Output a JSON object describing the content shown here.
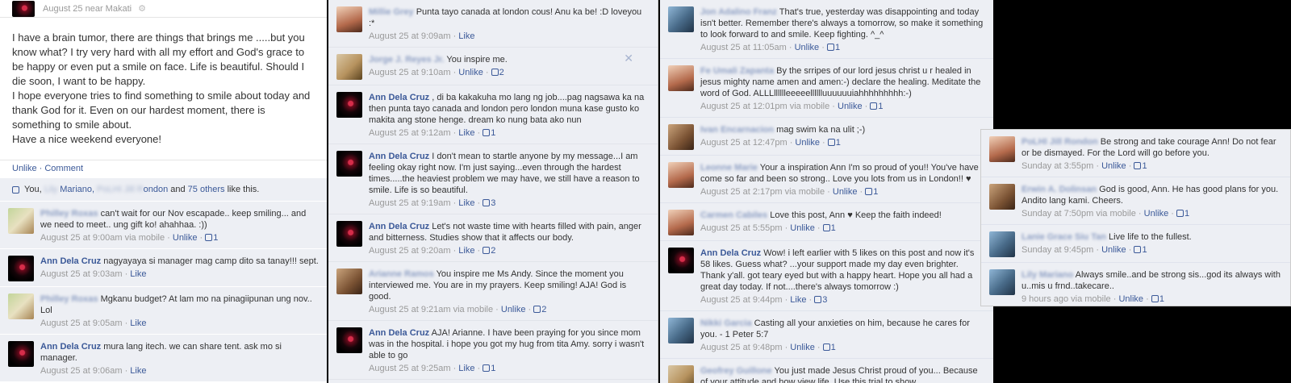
{
  "panel1": {
    "header_meta": "August 25 near Makati",
    "post_lines": [
      "I have a brain tumor, there are things that brings me .....but you know what? I try very hard with all my effort and God's grace to be happy or even put a smile on face. Life is beautiful. Should I die soon, I want to be happy.",
      "I hope everyone tries to find something to smile about today and thank God for it. Even on our hardest moment, there is something to smile about.",
      "Have a nice weekend everyone!"
    ],
    "unlike": "Unlike",
    "comment": "Comment",
    "likes_you": "You,",
    "likes_name1": "Mariano,",
    "likes_and": "and",
    "likes_others": "75 others",
    "likes_tail": "like this.",
    "comments": [
      {
        "name": "Philley Roxas",
        "text": "can't wait for our Nov escapade.. keep smiling... and we need to meet.. ung gift ko! ahahhaa. :))",
        "meta": "August 25 at 9:00am via mobile",
        "action": "Unlike",
        "count": "1"
      },
      {
        "name": "Ann Dela Cruz",
        "text": "nagyayaya si manager mag camp dito sa tanay!!! sept.",
        "meta": "August 25 at 9:03am",
        "action": "Like",
        "count": ""
      },
      {
        "name": "Philley Roxas",
        "text": "Mgkanu budget? At lam mo na pinagiipunan ung nov.. Lol",
        "meta": "August 25 at 9:05am",
        "action": "Like",
        "count": ""
      },
      {
        "name": "Ann Dela Cruz",
        "text": "mura lang itech. we can share tent. ask mo si manager.",
        "meta": "August 25 at 9:06am",
        "action": "Like",
        "count": ""
      }
    ]
  },
  "panel2": {
    "comments": [
      {
        "name": "Millie Grey",
        "text": "Punta tayo canada at london cous! Anu ka be! :D loveyou :*",
        "meta": "August 25 at 9:09am",
        "action": "Like",
        "count": ""
      },
      {
        "name": "Jorge J. Reyes Jr.",
        "text": "You inspire me.",
        "meta": "August 25 at 9:10am",
        "action": "Unlike",
        "count": "2"
      },
      {
        "name": "Ann Dela Cruz",
        "text": ", di ba kakakuha mo lang ng job....pag nagsawa ka na then punta tayo canada and london pero london muna kase gusto ko makita ang stone henge. dream ko nung bata ako nun",
        "meta": "August 25 at 9:12am",
        "action": "Like",
        "count": "1"
      },
      {
        "name": "Ann Dela Cruz",
        "text": "I don't mean to startle anyone by my message...I am feeling okay right now. I'm just saying...even through the hardest times.....the heaviest problem we may have, we still have a reason to smile. Life is so beautiful.",
        "meta": "August 25 at 9:19am",
        "action": "Like",
        "count": "3"
      },
      {
        "name": "Ann Dela Cruz",
        "text": "Let's not waste time with hearts filled with pain, anger and bitterness. Studies show that it affects our body.",
        "meta": "August 25 at 9:20am",
        "action": "Like",
        "count": "2"
      },
      {
        "name": "Arianne Ramos",
        "text": "You inspire me Ms Andy. Since the moment you interviewed me. You are in my prayers. Keep smiling! AJA! God is good.",
        "meta": "August 25 at 9:21am via mobile",
        "action": "Unlike",
        "count": "2"
      },
      {
        "name": "Ann Dela Cruz",
        "text": "AJA! Arianne. I have been praying for you since mom was in the hospital. i hope you got my hug from tita Amy. sorry i wasn't able to go",
        "meta": "August 25 at 9:25am",
        "action": "Like",
        "count": "1"
      }
    ]
  },
  "panel3": {
    "comments": [
      {
        "name": "Jon Adalino Franz",
        "text": "That's true, yesterday was disappointing and today isn't better. Remember there's always a tomorrow, so make it something to look forward to and smile. Keep fighting. ^_^",
        "meta": "August 25 at 11:05am",
        "action": "Unlike",
        "count": "1"
      },
      {
        "name": "Fe Umali Zapanta",
        "text": "By the srripes of our lord jesus christ u r healed in jesus mighty name amen and amen:-) declare the healing. Meditate the word of God. ALLLlllllleeeeelllllluuuuuuiahhhhhhhhh:-)",
        "meta": "August 25 at 12:01pm via mobile",
        "action": "Unlike",
        "count": "1"
      },
      {
        "name": "Ivan Encarnacion",
        "text": "mag swim ka na ulit ;-)",
        "meta": "August 25 at 12:47pm",
        "action": "Unlike",
        "count": "1"
      },
      {
        "name": "Leonne Marie",
        "text": "Your a inspiration Ann I'm so proud of you!! You've have come so far and been so strong.. Love you lots from us in London!! ♥",
        "meta": "August 25 at 2:17pm via mobile",
        "action": "Unlike",
        "count": "1"
      },
      {
        "name": "Carmen Cabiles",
        "text": "Love this post, Ann ♥ Keep the faith indeed!",
        "meta": "August 25 at 5:55pm",
        "action": "Unlike",
        "count": "1"
      },
      {
        "name": "Ann Dela Cruz",
        "text": "Wow! i left earlier with 5 likes on this post and now it's 58 likes. Guess what? ...your support made my day even brighter. Thank y'all. got teary eyed but with a happy heart. Hope you all had a great day today. If not....there's always tomorrow :)",
        "meta": "August 25 at 9:44pm",
        "action": "Like",
        "count": "3"
      },
      {
        "name": "Nikki Garcia",
        "text": "Casting all your anxieties on him, because he cares for you. - 1 Peter 5:7",
        "meta": "August 25 at 9:48pm",
        "action": "Unlike",
        "count": "1"
      },
      {
        "name": "Geofrey Guillone",
        "text": "You just made Jesus Christ proud of you... Because of your attitude and how view life. Use this trial to show",
        "meta": "",
        "action": "",
        "count": ""
      }
    ]
  },
  "panel4": {
    "comments": [
      {
        "name": "PoLHI Jill Rondon",
        "text": "Be strong and take courage Ann! Do not fear or be dismayed. For the Lord will go before you.",
        "meta": "Sunday at 3:55pm",
        "action": "Unlike",
        "count": "1"
      },
      {
        "name": "Erwin A. Dolinsan",
        "text": "God is good, Ann. He has good plans for you. Andito lang kami. Cheers.",
        "meta": "Sunday at 7:50pm via mobile",
        "action": "Unlike",
        "count": "1"
      },
      {
        "name": "Lanie Grace Siu Tan",
        "text": "Live life to the fullest.",
        "meta": "Sunday at 9:45pm",
        "action": "Unlike",
        "count": "1"
      },
      {
        "name": "Lily Mariano",
        "text": "Always smile..and be strong sis...god its always with u..mis u frnd..takecare..",
        "meta": "9 hours ago via mobile",
        "action": "Unlike",
        "count": "1"
      }
    ]
  }
}
